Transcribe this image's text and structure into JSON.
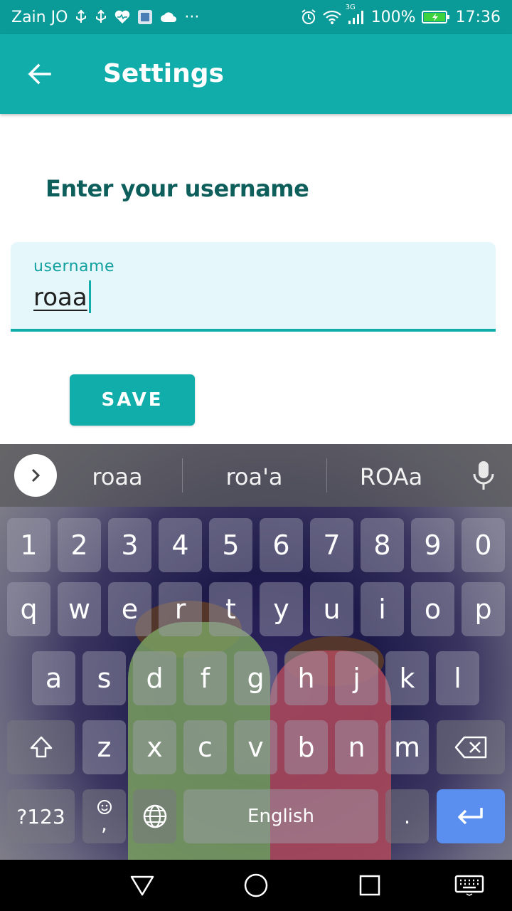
{
  "status_bar": {
    "carrier": "Zain JO",
    "battery": "100%",
    "time": "17:36",
    "network": "3G",
    "ellipsis": "···",
    "icons": [
      "usb-icon",
      "usb-icon",
      "health-icon",
      "app-icon",
      "cloud-icon",
      "alarm-icon",
      "wifi-icon",
      "signal-icon",
      "battery-charging-icon"
    ]
  },
  "app_bar": {
    "title": "Settings",
    "back_icon": "arrow-left-icon"
  },
  "content": {
    "heading": "Enter your username",
    "username_field": {
      "label": "username",
      "value": "roaa"
    },
    "save_label": "SAVE"
  },
  "keyboard": {
    "suggestions": [
      "roaa",
      "roa'a",
      "ROAa"
    ],
    "number_row": [
      "1",
      "2",
      "3",
      "4",
      "5",
      "6",
      "7",
      "8",
      "9",
      "0"
    ],
    "row1": [
      "q",
      "w",
      "e",
      "r",
      "t",
      "y",
      "u",
      "i",
      "o",
      "p"
    ],
    "row2": [
      "a",
      "s",
      "d",
      "f",
      "g",
      "h",
      "j",
      "k",
      "l"
    ],
    "row3": [
      "z",
      "x",
      "c",
      "v",
      "b",
      "n",
      "m"
    ],
    "symbols_label": "?123",
    "comma": ",",
    "space_label": "English",
    "period": "."
  },
  "colors": {
    "primary": "#11adaa",
    "status_bar": "#0a9b98",
    "heading": "#0e5f5c",
    "field_bg": "#e5f7fb",
    "enter_key": "#5a8ff0"
  }
}
